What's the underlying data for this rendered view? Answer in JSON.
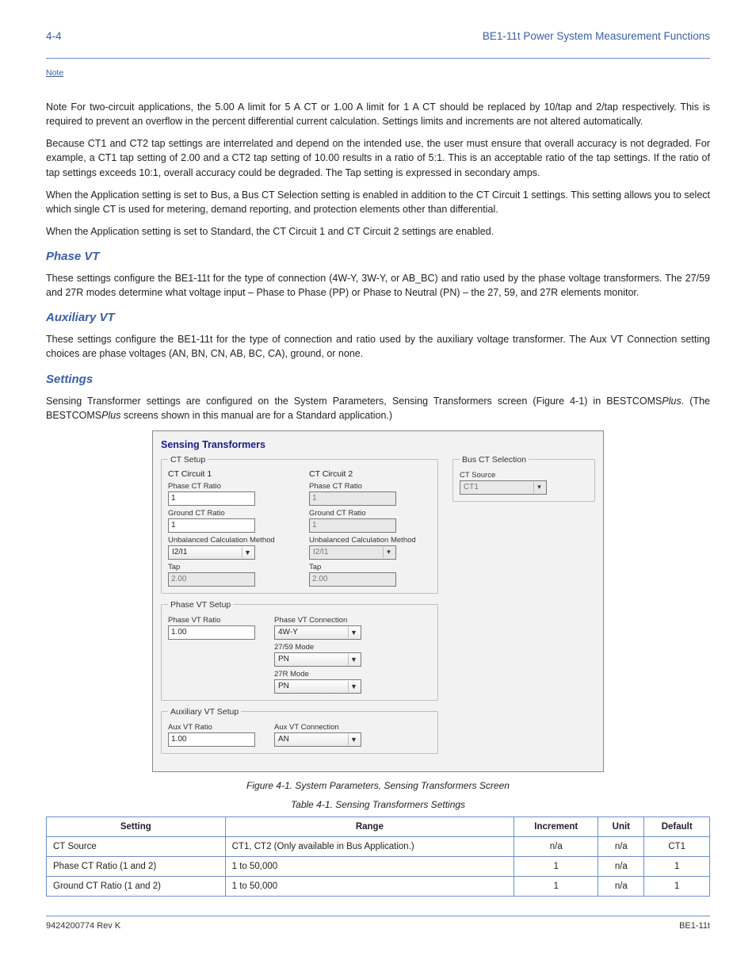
{
  "header": {
    "left": "4-4",
    "right": "BE1-11t Power System Measurement Functions",
    "sublink": "Note"
  },
  "para1a": "Note  For two-circuit applications, the 5.00 A limit for 5 A CT or 1.00 A limit for 1 A CT should be replaced by 10/tap and 2/tap respectively. This is required to prevent an overflow in the percent differential current calculation. Settings limits and increments are not altered automatically.",
  "para1b": "Because CT1 and CT2 tap settings are interrelated and depend on the intended use, the user must ensure that overall accuracy is not degraded. For example, a CT1 tap setting of 2.00 and a CT2 tap setting of 10.00 results in a ratio of 5:1. This is an acceptable ratio of the tap settings. If the ratio of tap settings exceeds 10:1, overall accuracy could be degraded. The Tap setting is expressed in secondary amps.",
  "para1c": "When the Application setting is set to Bus, a Bus CT Selection setting is enabled in addition to the CT Circuit 1 settings. This setting allows you to select which single CT is used for metering, demand reporting, and protection elements other than differential.",
  "para1d": "When the Application setting is set to Standard, the CT Circuit 1 and CT Circuit 2 settings are enabled.",
  "sec1": {
    "title": "Phase VT"
  },
  "para2": "These settings configure the BE1-11t for the type of connection (4W-Y, 3W-Y, or AB_BC) and ratio used by the phase voltage transformers. The 27/59 and 27R modes determine what voltage input – Phase to Phase (PP) or Phase to Neutral (PN) – the 27, 59, and 27R elements monitor.",
  "sec2": {
    "title": "Auxiliary VT"
  },
  "para3": "These settings configure the BE1-11t for the type of connection and ratio used by the auxiliary voltage transformer. The Aux VT Connection setting choices are phase voltages (AN, BN, CN, AB, BC, CA), ground, or none.",
  "sec3": {
    "title": "Settings"
  },
  "para4a": "Sensing Transformer settings are configured on the System Parameters, Sensing Transformers screen (",
  "para4b": ") in BESTCOMS",
  "para4c": ". (The BESTCOMS",
  "para4d": " screens shown in this manual are for a Standard application.)",
  "figref": "Figure 4-1",
  "tm": "Plus",
  "figure": {
    "title": "Sensing Transformers",
    "ct_setup": "CT Setup",
    "ctc1": "CT Circuit 1",
    "ctc2": "CT Circuit 2",
    "phase_ct_ratio": "Phase CT Ratio",
    "ground_ct_ratio": "Ground CT Ratio",
    "unbal": "Unbalanced Calculation Method",
    "tap": "Tap",
    "ct1": {
      "phase": "1",
      "ground": "1",
      "unbal": "I2/I1",
      "tap": "2.00"
    },
    "ct2": {
      "phase": "1",
      "ground": "1",
      "unbal": "I2/I1",
      "tap": "2.00"
    },
    "busct": {
      "title": "Bus CT Selection",
      "label": "CT Source",
      "value": "CT1"
    },
    "pvt": {
      "title": "Phase VT Setup",
      "ratio_label": "Phase VT Ratio",
      "ratio": "1.00",
      "conn_label": "Phase VT Connection",
      "conn": "4W-Y",
      "m2759_label": "27/59 Mode",
      "m2759": "PN",
      "m27r_label": "27R Mode",
      "m27r": "PN"
    },
    "avt": {
      "title": "Auxiliary VT Setup",
      "ratio_label": "Aux VT Ratio",
      "ratio": "1.00",
      "conn_label": "Aux VT Connection",
      "conn": "AN"
    }
  },
  "caption1": "Figure 4-1. System Parameters, Sensing Transformers Screen",
  "caption2": "Table 4-1. Sensing Transformers Settings",
  "table": {
    "headers": [
      "Setting",
      "Range",
      "Increment",
      "Unit",
      "Default"
    ],
    "rows": [
      [
        "CT Source",
        "CT1, CT2 (Only available in Bus Application.)",
        "n/a",
        "n/a",
        "CT1"
      ],
      [
        "Phase CT Ratio (1 and 2)",
        "1 to 50,000",
        "1",
        "n/a",
        "1"
      ],
      [
        "Ground CT Ratio (1 and 2)",
        "1 to 50,000",
        "1",
        "n/a",
        "1"
      ]
    ]
  },
  "footer": {
    "left": "9424200774 Rev K",
    "right": "BE1-11t"
  }
}
